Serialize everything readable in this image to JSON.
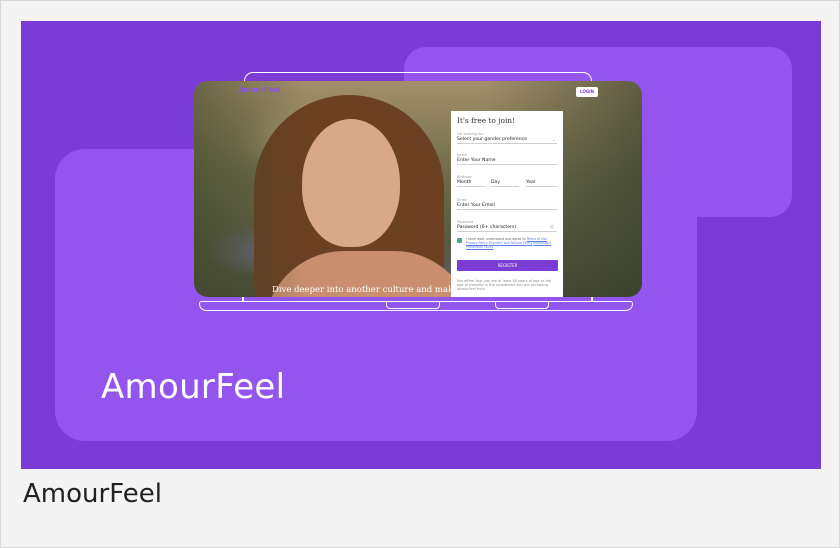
{
  "hero": {
    "brand_title": "AmourFeel",
    "colors": {
      "background": "#7b3cd6",
      "blob": "#9355ee",
      "accent": "#8f53e8"
    }
  },
  "screen": {
    "logo": "AmourFeel",
    "login_label": "LOGIN",
    "tagline": "Dive deeper into another culture and make some",
    "form": {
      "title": "It's free to join!",
      "seeking_label": "I'm seeking for",
      "seeking_value": "Select your gender preference",
      "name_label": "Name",
      "name_placeholder": "Enter Your Name",
      "birthday_label": "Birthday",
      "month": "Month",
      "day": "Day",
      "year": "Year",
      "email_label": "Email",
      "email_placeholder": "Enter Your Email",
      "password_label": "Password",
      "password_placeholder": "Password (6+ characters)",
      "terms_prefix": "I have read, understand and agree to",
      "terms_link1": "Terms of Use",
      "terms_link2": "Privacy Policy",
      "terms_link3": "Payment and Refund Policy",
      "terms_link4": "Misconduct Prevention Policy",
      "register_label": "REGISTER",
      "note": "You affirm that you are at least 18 years of age or the age of majority in the jurisdiction you are accessing AmourFeel from."
    }
  },
  "caption": "AmourFeel"
}
